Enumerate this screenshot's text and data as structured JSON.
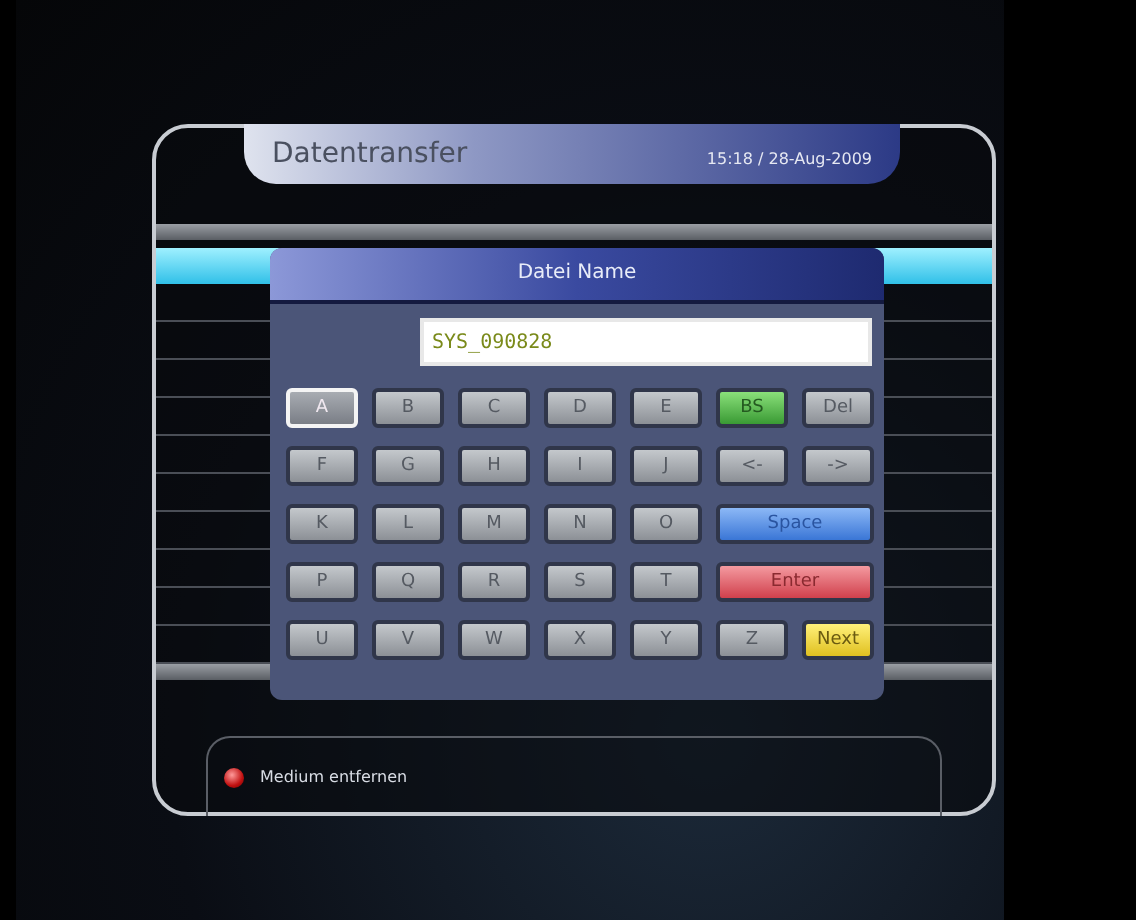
{
  "header": {
    "title": "Datentransfer",
    "datetime": "15:18 / 28-Aug-2009"
  },
  "dialog": {
    "title": "Datei Name",
    "input": {
      "value": "SYS_090828"
    },
    "keys": [
      {
        "label": "A",
        "kind": "letter",
        "selected": true
      },
      {
        "label": "B",
        "kind": "letter",
        "selected": false
      },
      {
        "label": "C",
        "kind": "letter",
        "selected": false
      },
      {
        "label": "D",
        "kind": "letter",
        "selected": false
      },
      {
        "label": "E",
        "kind": "letter",
        "selected": false
      },
      {
        "label": "BS",
        "kind": "green",
        "selected": false
      },
      {
        "label": "Del",
        "kind": "letter",
        "selected": false
      },
      {
        "label": "F",
        "kind": "letter",
        "selected": false
      },
      {
        "label": "G",
        "kind": "letter",
        "selected": false
      },
      {
        "label": "H",
        "kind": "letter",
        "selected": false
      },
      {
        "label": "I",
        "kind": "letter",
        "selected": false
      },
      {
        "label": "J",
        "kind": "letter",
        "selected": false
      },
      {
        "label": "<-",
        "kind": "letter",
        "selected": false
      },
      {
        "label": "->",
        "kind": "letter",
        "selected": false
      },
      {
        "label": "K",
        "kind": "letter",
        "selected": false
      },
      {
        "label": "L",
        "kind": "letter",
        "selected": false
      },
      {
        "label": "M",
        "kind": "letter",
        "selected": false
      },
      {
        "label": "N",
        "kind": "letter",
        "selected": false
      },
      {
        "label": "O",
        "kind": "letter",
        "selected": false
      },
      {
        "label": "Space",
        "kind": "blue",
        "selected": false
      },
      {
        "label": "P",
        "kind": "letter",
        "selected": false
      },
      {
        "label": "Q",
        "kind": "letter",
        "selected": false
      },
      {
        "label": "R",
        "kind": "letter",
        "selected": false
      },
      {
        "label": "S",
        "kind": "letter",
        "selected": false
      },
      {
        "label": "T",
        "kind": "letter",
        "selected": false
      },
      {
        "label": "Enter",
        "kind": "red",
        "selected": false
      },
      {
        "label": "U",
        "kind": "letter",
        "selected": false
      },
      {
        "label": "V",
        "kind": "letter",
        "selected": false
      },
      {
        "label": "W",
        "kind": "letter",
        "selected": false
      },
      {
        "label": "X",
        "kind": "letter",
        "selected": false
      },
      {
        "label": "Y",
        "kind": "letter",
        "selected": false
      },
      {
        "label": "Z",
        "kind": "letter",
        "selected": false
      },
      {
        "label": "Next",
        "kind": "yellow",
        "selected": false
      }
    ]
  },
  "footer": {
    "hint": "Medium entfernen"
  }
}
